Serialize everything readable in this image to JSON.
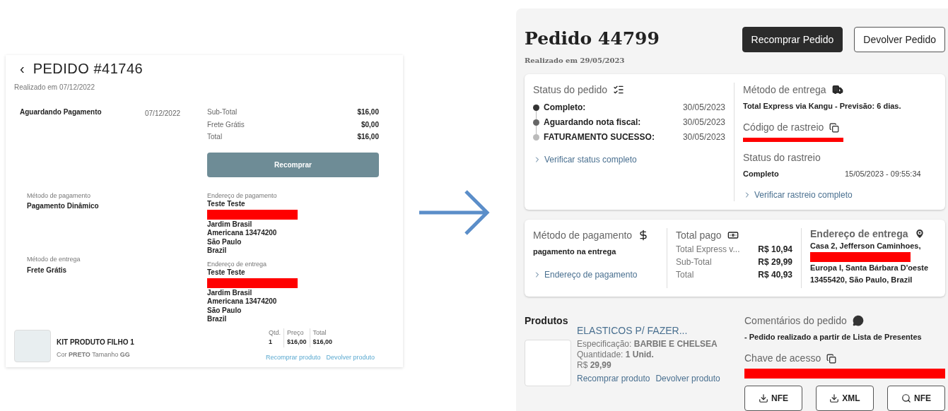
{
  "old_order": {
    "title": "PEDIDO #41746",
    "back_icon": "‹",
    "placed_on": "Realizado em 07/12/2022",
    "status": "Aguardando Pagamento",
    "status_date": "07/12/2022",
    "totals": [
      {
        "label": "Sub-Total",
        "value": "$16,00"
      },
      {
        "label": "Frete Grátis",
        "value": "$0,00"
      },
      {
        "label": "Total",
        "value": "$16,00"
      }
    ],
    "rebuy_button": "Recomprar",
    "payment_method": {
      "label": "Método de pagamento",
      "value": "Pagamento Dinâmico"
    },
    "delivery_method": {
      "label": "Método de entrega",
      "value": "Frete Grátis"
    },
    "addresses": [
      {
        "label": "Endereço de pagamento",
        "name": "Teste Teste",
        "lines": [
          "Jardim Brasil",
          "Americana 13474200",
          "São Paulo",
          "Brazil"
        ]
      },
      {
        "label": "Endereço de entrega",
        "name": "Teste Teste",
        "lines": [
          "Jardim Brasil",
          "Americana 13474200",
          "São Paulo",
          "Brazil"
        ]
      }
    ],
    "product": {
      "name": "KIT PRODUTO FILHO 1",
      "spec": "Cor **PRETO** Tamanho **GG**",
      "columns": [
        {
          "label": "Qtd.",
          "value": "1"
        },
        {
          "label": "Preço",
          "value": "$16,00"
        },
        {
          "label": "Total",
          "value": "$16,00"
        }
      ],
      "links": [
        "Recomprar produto",
        "Devolver produto"
      ]
    }
  },
  "new_order": {
    "title": "Pedido 44799",
    "placed_on": "Realizado em 29/05/2023",
    "buttons": [
      {
        "label": "Recomprar Pedido",
        "kind": "primary"
      },
      {
        "label": "Devolver Pedido",
        "kind": "secondary"
      }
    ],
    "order_status": {
      "label": "Status do pedido",
      "steps": [
        {
          "label": "Completo:",
          "date": "30/05/2023",
          "color": "#333333"
        },
        {
          "label": "Aguardando nota fiscal:",
          "date": "30/05/2023",
          "color": "#666666"
        },
        {
          "label": "FATURAMENTO SUCESSO:",
          "date": "30/05/2023",
          "color": "#bbbbbb"
        }
      ],
      "link": "Verificar status completo"
    },
    "delivery": {
      "label": "Método de entrega",
      "value": "Total Express via Kangu - Previsão: 6 dias.",
      "tracking_code_label": "Código de rastreio",
      "tracking_status_label": "Status do rastreio",
      "tracking_status": "Completo",
      "tracking_date": "15/05/2023 - 09:55:34",
      "link": "Verificar rastreio completo"
    },
    "payment": {
      "label": "Método de pagamento",
      "value": "pagamento na entrega",
      "link": "Endereço de pagamento"
    },
    "total_paid": {
      "label": "Total pago",
      "rows": [
        {
          "label": "Total Express v...",
          "value": "R$ 10,94"
        },
        {
          "label": "Sub-Total",
          "value": "R$ 29,99"
        },
        {
          "label": "Total",
          "value": "R$ 40,93"
        }
      ]
    },
    "shipping_address": {
      "label": "Endereço de entrega",
      "first_line": "Casa 2, Jefferson Caminhoes,",
      "rest": "Europa I, Santa Bárbara D'oeste 13455420, São Paulo, Brazil"
    },
    "products": {
      "title": "Produtos",
      "name": "ELASTICOS P/ FAZER...",
      "spec": "Especificação: **BARBIE E CHELSEA**",
      "quantity": "Quantidade: **1 Unid.**",
      "price": "R$ **29,99**",
      "links": [
        "Recomprar produto",
        "Devolver produto"
      ]
    },
    "comments": {
      "label": "Comentários do pedido",
      "text": "- Pedido realizado a partir de Lista de Presentes"
    },
    "access_key": {
      "label": "Chave de acesso"
    },
    "doc_buttons": [
      {
        "label": "NFE",
        "kind": "download"
      },
      {
        "label": "XML",
        "kind": "download"
      },
      {
        "label": "NFE",
        "kind": "search"
      }
    ]
  }
}
